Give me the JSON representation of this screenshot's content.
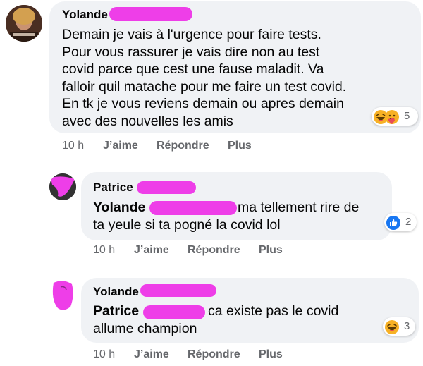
{
  "comments": [
    {
      "author": "Yolande",
      "lines": [
        "Demain je vais à l'urgence pour faire tests.",
        "Pour vous rassurer je vais dire non au test",
        "covid parce que cest une fause maladit. Va",
        "falloir quil matache pour me faire un test covid.",
        "En tk je vous reviens demain ou apres demain",
        "avec des nouvelles les amis"
      ],
      "reaction_count": "5",
      "reaction_icons": [
        "haha-icon",
        "care-icon"
      ],
      "time": "10 h",
      "like": "J’aime",
      "reply": "Répondre",
      "more": "Plus"
    },
    {
      "author": "Patrice",
      "mention": "Yolande",
      "line1": "ma tellement rire de",
      "line2": "ta yeule si ta pogné la covid lol",
      "reaction_count": "2",
      "reaction_icons": [
        "like-icon"
      ],
      "time": "10 h",
      "like": "J’aime",
      "reply": "Répondre",
      "more": "Plus"
    },
    {
      "author": "Yolande",
      "mention": "Patrice",
      "line1": "ca existe pas le covid",
      "line2": "allume champion",
      "reaction_count": "3",
      "reaction_icons": [
        "haha-icon"
      ],
      "time": "10 h",
      "like": "J’aime",
      "reply": "Répondre",
      "more": "Plus"
    }
  ],
  "colors": {
    "redaction": "#ee3ee8",
    "bubble": "#f0f2f5",
    "meta": "#65676b",
    "like_blue": "#1877f2",
    "haha_yellow": "#f7b125"
  }
}
